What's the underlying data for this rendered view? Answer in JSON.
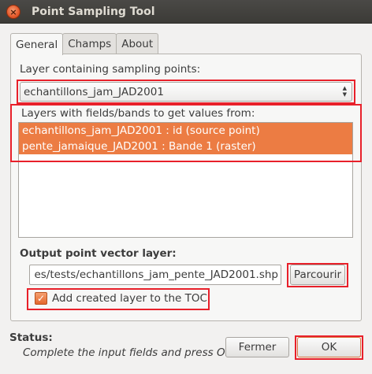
{
  "window": {
    "title": "Point Sampling Tool",
    "close_glyph": "×"
  },
  "tabs": [
    {
      "label": "General",
      "active": true
    },
    {
      "label": "Champs",
      "active": false
    },
    {
      "label": "About",
      "active": false
    }
  ],
  "general": {
    "sampling_label": "Layer containing sampling points:",
    "sampling_value": "echantillons_jam_JAD2001",
    "fields_label": "Layers with fields/bands to get values from:",
    "fields_items": [
      "echantillons_jam_JAD2001 : id (source point)",
      "pente_jamaique_JAD2001 : Bande 1 (raster)"
    ],
    "output_label": "Output point vector layer:",
    "output_path": "es/tests/echantillons_jam_pente_JAD2001.shp",
    "browse_label": "Parcourir",
    "add_to_toc_label": "Add created layer to the TOC",
    "add_to_toc_checked": true
  },
  "status": {
    "label": "Status:",
    "message": "Complete the input fields and press OK"
  },
  "buttons": {
    "close_label": "Fermer",
    "ok_label": "OK"
  },
  "colors": {
    "accent": "#ec7c43",
    "highlight": "#e8202a"
  }
}
